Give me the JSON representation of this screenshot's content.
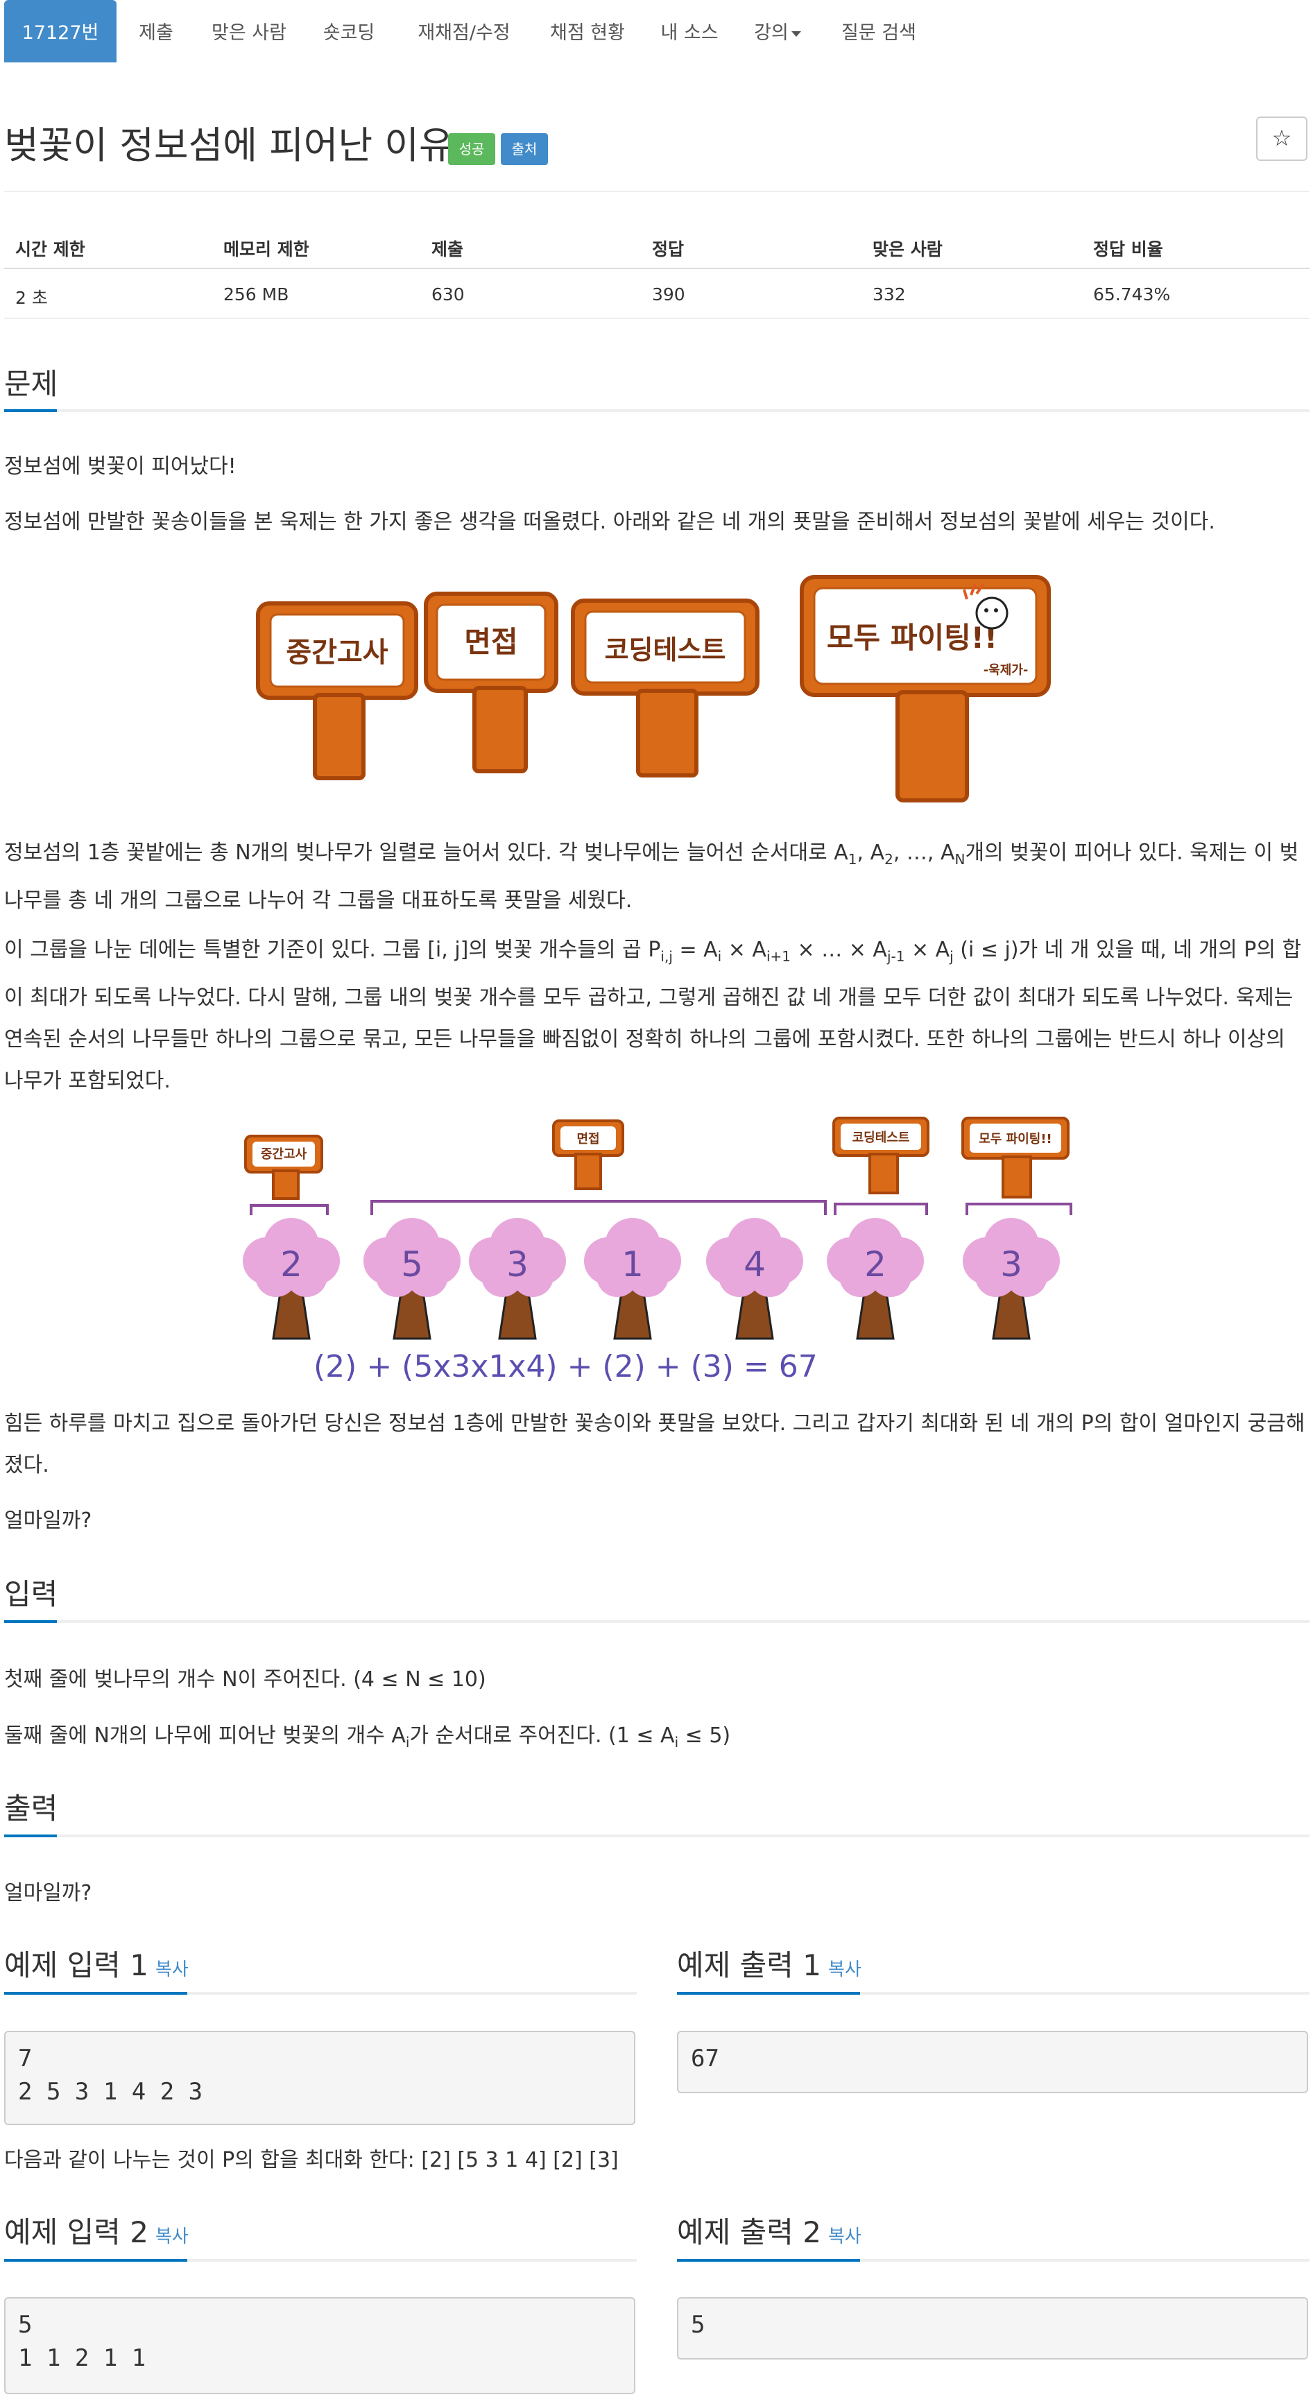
{
  "nav": {
    "tabs": [
      "17127번",
      "제출",
      "맞은 사람",
      "숏코딩",
      "재채점/수정",
      "채점 현황",
      "내 소스",
      "강의",
      "질문 검색"
    ]
  },
  "title": "벚꽃이 정보섬에 피어난 이유",
  "badges": {
    "success": "성공",
    "source": "출처"
  },
  "colors": {
    "primary": "#428bca",
    "success": "#5cb85c",
    "accent": "#0076c0"
  },
  "star_icon": "star-icon",
  "stats": {
    "headers": [
      "시간 제한",
      "메모리 제한",
      "제출",
      "정답",
      "맞은 사람",
      "정답 비율"
    ],
    "values": [
      "2 초",
      "256 MB",
      "630",
      "390",
      "332",
      "65.743%"
    ]
  },
  "problem": {
    "heading": "문제",
    "p1": "정보섬에 벚꽃이 피어났다!",
    "p2": "정보섬에 만발한 꽃송이들을 본 욱제는 한 가지 좋은 생각을 떠올렸다. 아래와 같은 네 개의 푯말을 준비해서 정보섬의 꽃밭에 세우는 것이다.",
    "signs": [
      "중간고사",
      "면접",
      "코딩테스트",
      "모두 파이팅!!",
      "-욱제가-"
    ],
    "p3a": "정보섬의 1층 꽃밭에는 총 N개의 벚나무가 일렬로 늘어서 있다. 각 벚나무에는 늘어선 순서대로 A",
    "p3b": "개의 벚꽃이 피어나 있다. 욱제는 이 벚나무를 총 네 개의 그룹으로 나누어 각 그룹을 대표하도록 푯말을 세웠다.",
    "p4a": "이 그룹을 나눈 데에는 특별한 기준이 있다. 그룹 [i, j]의 벚꽃 개수들의 곱 P",
    "p4b": "가 네 개 있을 때, 네 개의 P의 합이 최대가 되도록 나누었다. 다시 말해, 그룹 내의 벚꽃 개수를 모두 곱하고, 그렇게 곱해진 값 네 개를 모두 더한 값이 최대가 되도록 나누었다. 욱제는 연속된 순서의 나무들만 하나의 그룹으로 묶고, 모든 나무들을 빠짐없이 정확히 하나의 그룹에 포함시켰다. 또한 하나의 그룹에는 반드시 하나 이상의 나무가 포함되었다.",
    "trees": [
      "2",
      "5",
      "3",
      "1",
      "4",
      "2",
      "3"
    ],
    "formula": "(2) + (5x3x1x4) + (2) + (3) = 67",
    "p5": "힘든 하루를 마치고 집으로 돌아가던 당신은 정보섬 1층에 만발한 꽃송이와 푯말을 보았다. 그리고 갑자기 최대화 된 네 개의 P의 합이 얼마인지 궁금해졌다.",
    "p6": "얼마일까?"
  },
  "input": {
    "heading": "입력",
    "line1": "첫째 줄에 벚나무의 개수 N이 주어진다. (4 ≤ N ≤ 10)",
    "line2a": "둘째 줄에 N개의 나무에 피어난 벚꽃의 개수 A",
    "line2b": "가 순서대로 주어진다. (1 ≤ A",
    "line2c": " ≤ 5)"
  },
  "output": {
    "heading": "출력",
    "text": "얼마일까?"
  },
  "examples": {
    "copy": "복사",
    "in1_title": "예제 입력 1",
    "out1_title": "예제 출력 1",
    "in1": "7\n2 5 3 1 4 2 3",
    "out1": "67",
    "note1": "다음과 같이 나누는 것이 P의 합을 최대화 한다: [2] [5 3 1 4] [2] [3]",
    "in2_title": "예제 입력 2",
    "out2_title": "예제 출력 2",
    "in2": "5\n1 1 2 1 1",
    "out2": "5"
  }
}
